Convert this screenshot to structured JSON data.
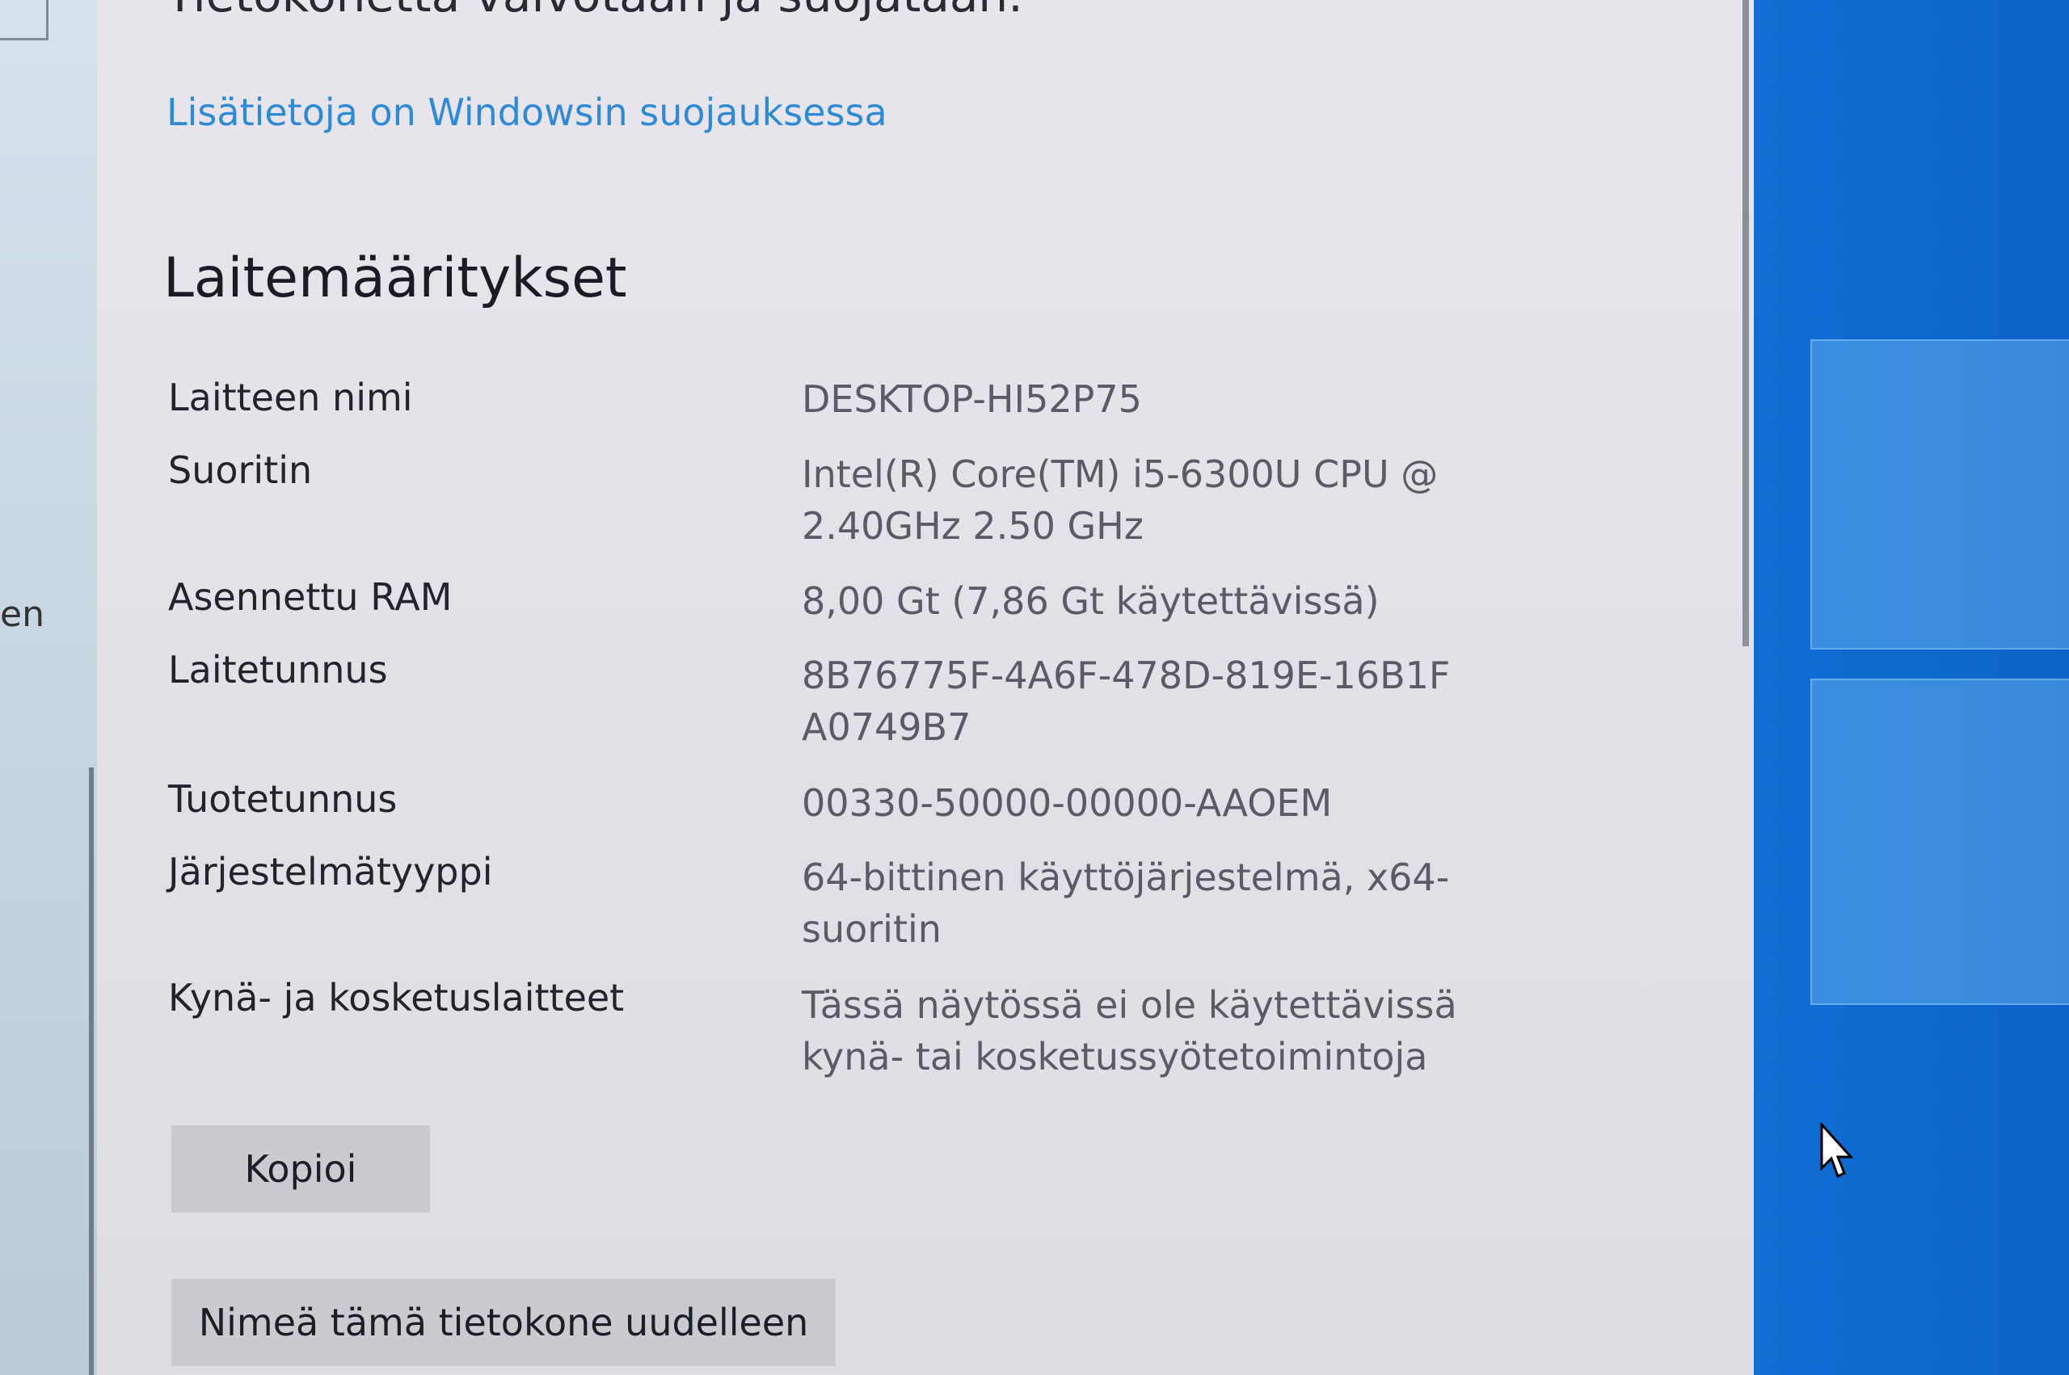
{
  "header": {
    "top_cut_text": "Tietokonetta valvotaan ja suojataan.",
    "security_link": "Lisätietoja on Windowsin suojauksessa"
  },
  "sidebar": {
    "cut_label": "en"
  },
  "device_specs": {
    "title": "Laitemääritykset",
    "rows": [
      {
        "label": "Laitteen nimi",
        "value": "DESKTOP-HI52P75"
      },
      {
        "label": "Suoritin",
        "value": "Intel(R) Core(TM) i5-6300U CPU @ 2.40GHz   2.50 GHz"
      },
      {
        "label": "Asennettu RAM",
        "value": "8,00 Gt (7,86 Gt käytettävissä)"
      },
      {
        "label": "Laitetunnus",
        "value": "8B76775F-4A6F-478D-819E-16B1FA0749B7"
      },
      {
        "label": "Tuotetunnus",
        "value": "00330-50000-00000-AAOEM"
      },
      {
        "label": "Järjestelmätyyppi",
        "value": "64-bittinen käyttöjärjestelmä, x64-suoritin"
      },
      {
        "label": "Kynä- ja kosketuslaitteet",
        "value": "Tässä näytössä ei ole käytettävissä kynä- tai kosketussyötetoimintoja"
      }
    ]
  },
  "buttons": {
    "copy": "Kopioi",
    "rename": "Nimeä tämä tietokone uudelleen"
  },
  "icons": {
    "cursor": "mouse-pointer-icon",
    "windows_logo": "windows-logo"
  }
}
